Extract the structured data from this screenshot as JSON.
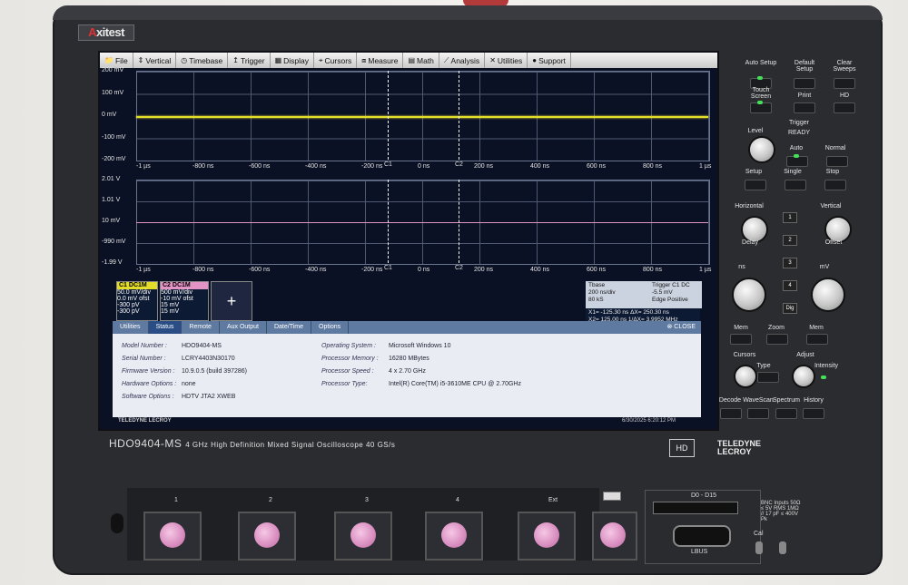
{
  "brand": {
    "prefix": "A",
    "rest": "xitest"
  },
  "menu": [
    {
      "icon": "📁",
      "label": "File",
      "name": "menu-file"
    },
    {
      "icon": "⇕",
      "label": "Vertical",
      "name": "menu-vertical"
    },
    {
      "icon": "◷",
      "label": "Timebase",
      "name": "menu-timebase"
    },
    {
      "icon": "↥",
      "label": "Trigger",
      "name": "menu-trigger"
    },
    {
      "icon": "▦",
      "label": "Display",
      "name": "menu-display"
    },
    {
      "icon": "⌖",
      "label": "Cursors",
      "name": "menu-cursors"
    },
    {
      "icon": "⧈",
      "label": "Measure",
      "name": "menu-measure"
    },
    {
      "icon": "▤",
      "label": "Math",
      "name": "menu-math"
    },
    {
      "icon": "⟋",
      "label": "Analysis",
      "name": "menu-analysis"
    },
    {
      "icon": "✕",
      "label": "Utilities",
      "name": "menu-utilities"
    },
    {
      "icon": "●",
      "label": "Support",
      "name": "menu-support"
    }
  ],
  "grid1": {
    "ylabels": [
      "200 mV",
      "100 mV",
      "0 mV",
      "-100 mV",
      "-200 mV"
    ],
    "xlabels": [
      "-1 µs",
      "-800 ns",
      "-600 ns",
      "-400 ns",
      "-200 ns",
      "0 ns",
      "200 ns",
      "400 ns",
      "600 ns",
      "800 ns",
      "1 µs"
    ]
  },
  "grid2": {
    "ylabels": [
      "2.01 V",
      "1.01 V",
      "10 mV",
      "-990 mV",
      "-1.99 V"
    ],
    "xlabels": [
      "-1 µs",
      "-800 ns",
      "-600 ns",
      "-400 ns",
      "-200 ns",
      "0 ns",
      "200 ns",
      "400 ns",
      "600 ns",
      "800 ns",
      "1 µs"
    ]
  },
  "cursors": {
    "c1": "C1",
    "c2": "C2"
  },
  "channels": {
    "c1": {
      "tag": "C1",
      "coupling": "DC1M",
      "lines": [
        "50.0 mV/div",
        "0.0 mV ofst",
        "-300 pV",
        "-300 pV"
      ]
    },
    "c2": {
      "tag": "C2",
      "coupling": "DC1M",
      "lines": [
        "500 mV/div",
        "-10 mV ofst",
        "15 mV",
        "15 mV"
      ]
    }
  },
  "timebase": {
    "lines": [
      "Tbase",
      "200 ns/div",
      "80 kS",
      "20 GS/s"
    ]
  },
  "trigger_box": {
    "lines": [
      "Trigger  C1 DC",
      "-5.5 mV",
      "Edge  Positive"
    ]
  },
  "measure": {
    "lines": [
      "X1= -125.30 ns   ΔX=  250.30 ns",
      "X2=  125.00 ns  1/ΔX= 3.9952 MHz"
    ]
  },
  "dialog": {
    "tabs": [
      "Utilities",
      "Status",
      "Remote",
      "Aux Output",
      "Date/Time",
      "Options"
    ],
    "active_tab": "Status",
    "close": "CLOSE",
    "left": [
      {
        "label": "Model Number :",
        "value": "HDO9404-MS"
      },
      {
        "label": "Serial Number :",
        "value": "LCRY4403N30170"
      },
      {
        "label": "Firmware Version :",
        "value": "10.9.0.5  (build 397286)"
      },
      {
        "label": "Hardware Options :",
        "value": "none"
      },
      {
        "label": "Software Options :",
        "value": "HDTV JTA2 XWEB"
      }
    ],
    "right": [
      {
        "label": "Operating System :",
        "value": "Microsoft Windows 10"
      },
      {
        "label": "Processor Memory :",
        "value": "16280 MBytes"
      },
      {
        "label": "Processor Speed :",
        "value": "4 x 2.70 GHz"
      },
      {
        "label": "Processor Type:",
        "value": "Intel(R) Core(TM) i5-3610ME CPU @ 2.70GHz"
      }
    ]
  },
  "footer": {
    "brand": "TELEDYNE LECROY",
    "datetime": "6/30/2025 6:20:12 PM"
  },
  "device": {
    "model": "HDO9404-MS",
    "desc": "4 GHz High Definition Mixed Signal Oscilloscope   40 GS/s",
    "hd": "HD",
    "logo_line1": "TELEDYNE",
    "logo_line2": "LECROY"
  },
  "panel": {
    "auto_setup": "Auto Setup",
    "default_setup": "Default Setup",
    "clear_sweeps": "Clear Sweeps",
    "touch_screen": "Touch Screen",
    "print": "Print",
    "hd": "HD",
    "trigger": "Trigger",
    "ready": "READY",
    "level": "Level",
    "auto": "Auto",
    "normal": "Normal",
    "setup": "Setup",
    "single": "Single",
    "stop": "Stop",
    "horizontal": "Horizontal",
    "vertical": "Vertical",
    "delay": "Delay",
    "offset": "Offset",
    "ns": "ns",
    "mv": "mV",
    "dig": "Dig",
    "mem": "Mem",
    "zoom": "Zoom",
    "math": "Mem",
    "cursors": "Cursors",
    "type": "Type",
    "adjust": "Adjust",
    "intensity": "Intensity",
    "decode": "Decode",
    "wavescan": "WaveScan",
    "spectrum": "Spectrum",
    "history": "History",
    "ch_nums": [
      "1",
      "2",
      "3",
      "4"
    ]
  },
  "front": {
    "inputs": [
      "1",
      "2",
      "3",
      "4",
      "Ext"
    ],
    "d_label": "D0 - D15",
    "lbus": "LBUS",
    "cal": "Cal",
    "bnc_info": "BNC Inputs 50Ω ≤ 5V RMS 1MΩ // 17 pF ≤ 400V Pk"
  }
}
